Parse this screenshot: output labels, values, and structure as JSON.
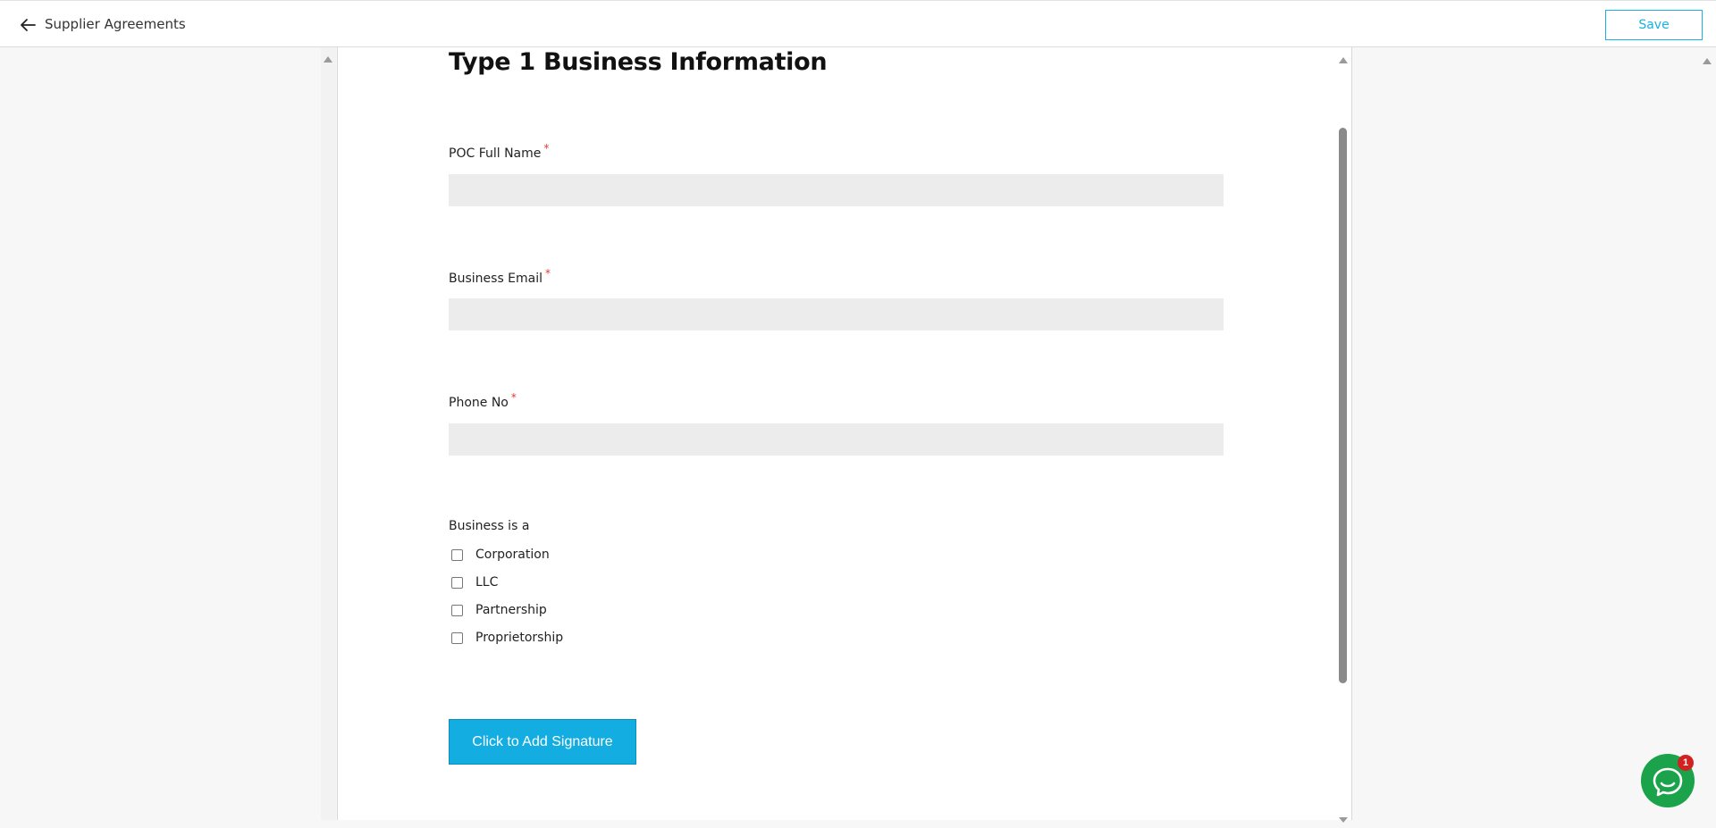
{
  "header": {
    "title": "Supplier Agreements",
    "save_label": "Save"
  },
  "form": {
    "title": "Type 1 Business Information",
    "fields": [
      {
        "label": "POC Full Name",
        "required_mark": "*",
        "value": ""
      },
      {
        "label": "Business Email",
        "required_mark": "*",
        "value": ""
      },
      {
        "label": "Phone No",
        "required_mark": "*",
        "value": ""
      }
    ],
    "business_type": {
      "label": "Business is a",
      "options": [
        "Corporation",
        "LLC",
        "Partnership",
        "Proprietorship"
      ]
    },
    "signature_button": "Click to Add Signature"
  },
  "chat": {
    "badge_count": "1"
  },
  "colors": {
    "accent": "#14ade2",
    "required": "#e53935",
    "chat": "#1aa34a",
    "badge": "#d32020"
  }
}
